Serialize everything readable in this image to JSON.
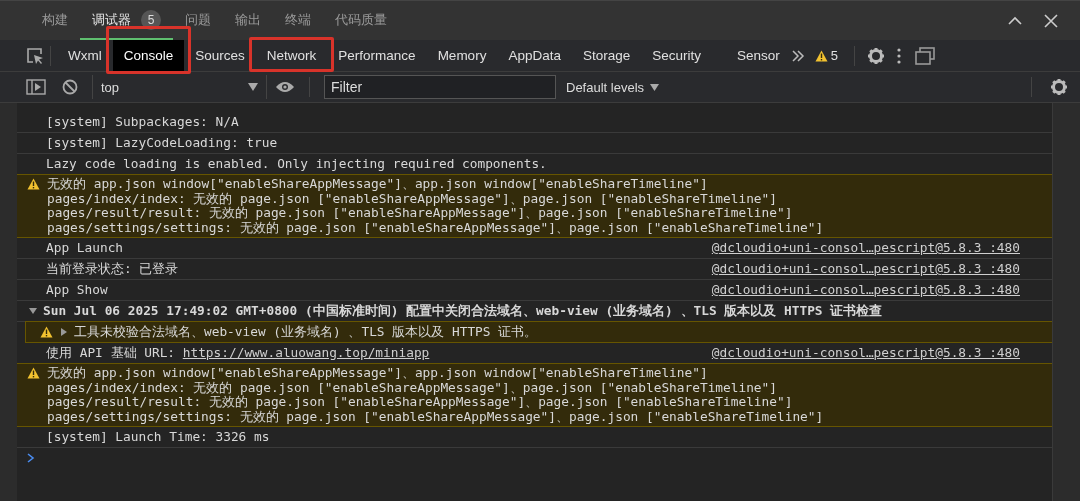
{
  "panel_tabs": [
    {
      "label": "构建",
      "selected": false
    },
    {
      "label": "调试器",
      "selected": true,
      "badge": "5"
    },
    {
      "label": "问题",
      "selected": false
    },
    {
      "label": "输出",
      "selected": false
    },
    {
      "label": "终端",
      "selected": false
    },
    {
      "label": "代码质量",
      "selected": false
    }
  ],
  "devtools_tabs": [
    {
      "label": "Wxml",
      "selected": false,
      "highlighted": false
    },
    {
      "label": "Console",
      "selected": true,
      "highlighted": true
    },
    {
      "label": "Sources",
      "selected": false,
      "highlighted": false
    },
    {
      "label": "Network",
      "selected": false,
      "highlighted": true
    },
    {
      "label": "Performance",
      "selected": false,
      "highlighted": false
    },
    {
      "label": "Memory",
      "selected": false,
      "highlighted": false
    },
    {
      "label": "AppData",
      "selected": false,
      "highlighted": false
    },
    {
      "label": "Storage",
      "selected": false,
      "highlighted": false
    },
    {
      "label": "Security",
      "selected": false,
      "highlighted": false
    },
    {
      "label": "Sensor",
      "selected": false,
      "highlighted": false
    }
  ],
  "warning_count": "5",
  "console_toolbar": {
    "context": "top",
    "filter_placeholder": "Filter",
    "levels": "Default levels"
  },
  "messages": [
    {
      "kind": "log",
      "lines": [
        "[system] Subpackages: N/A"
      ]
    },
    {
      "kind": "log",
      "lines": [
        "[system] LazyCodeLoading: true"
      ]
    },
    {
      "kind": "log",
      "lines": [
        "Lazy code loading is enabled. Only injecting required components."
      ]
    },
    {
      "kind": "warning",
      "lines": [
        "无效的 app.json window[\"enableShareAppMessage\"]、app.json window[\"enableShareTimeline\"]",
        "pages/index/index: 无效的 page.json [\"enableShareAppMessage\"]、page.json [\"enableShareTimeline\"]",
        "pages/result/result: 无效的 page.json [\"enableShareAppMessage\"]、page.json [\"enableShareTimeline\"]",
        "pages/settings/settings: 无效的 page.json [\"enableShareAppMessage\"]、page.json [\"enableShareTimeline\"]"
      ]
    },
    {
      "kind": "log",
      "lines": [
        "App Launch"
      ],
      "source": "@dcloudio+uni-consol…pescript@5.8.3 :480"
    },
    {
      "kind": "log",
      "lines": [
        "当前登录状态: 已登录"
      ],
      "source": "@dcloudio+uni-consol…pescript@5.8.3 :480"
    },
    {
      "kind": "log",
      "lines": [
        "App Show"
      ],
      "source": "@dcloudio+uni-consol…pescript@5.8.3 :480"
    },
    {
      "kind": "group",
      "expanded": true,
      "lines": [
        "Sun Jul 06 2025 17:49:02 GMT+0800 (中国标准时间) 配置中关闭合法域名、web-view (业务域名) 、TLS 版本以及 HTTPS 证书检查"
      ],
      "children": [
        {
          "kind": "warning",
          "expanded": false,
          "lines": [
            "工具未校验合法域名、web-view (业务域名) 、TLS 版本以及 HTTPS 证书。"
          ]
        }
      ]
    },
    {
      "kind": "log",
      "lines": [
        "使用 API 基础 URL: "
      ],
      "link": "https://www.aluowang.top/miniapp",
      "source": "@dcloudio+uni-consol…pescript@5.8.3 :480"
    },
    {
      "kind": "warning",
      "lines": [
        "无效的 app.json window[\"enableShareAppMessage\"]、app.json window[\"enableShareTimeline\"]",
        "pages/index/index: 无效的 page.json [\"enableShareAppMessage\"]、page.json [\"enableShareTimeline\"]",
        "pages/result/result: 无效的 page.json [\"enableShareAppMessage\"]、page.json [\"enableShareTimeline\"]",
        "pages/settings/settings: 无效的 page.json [\"enableShareAppMessage\"]、page.json [\"enableShareTimeline\"]"
      ]
    },
    {
      "kind": "log",
      "lines": [
        "[system] Launch Time: 3326 ms"
      ]
    }
  ]
}
